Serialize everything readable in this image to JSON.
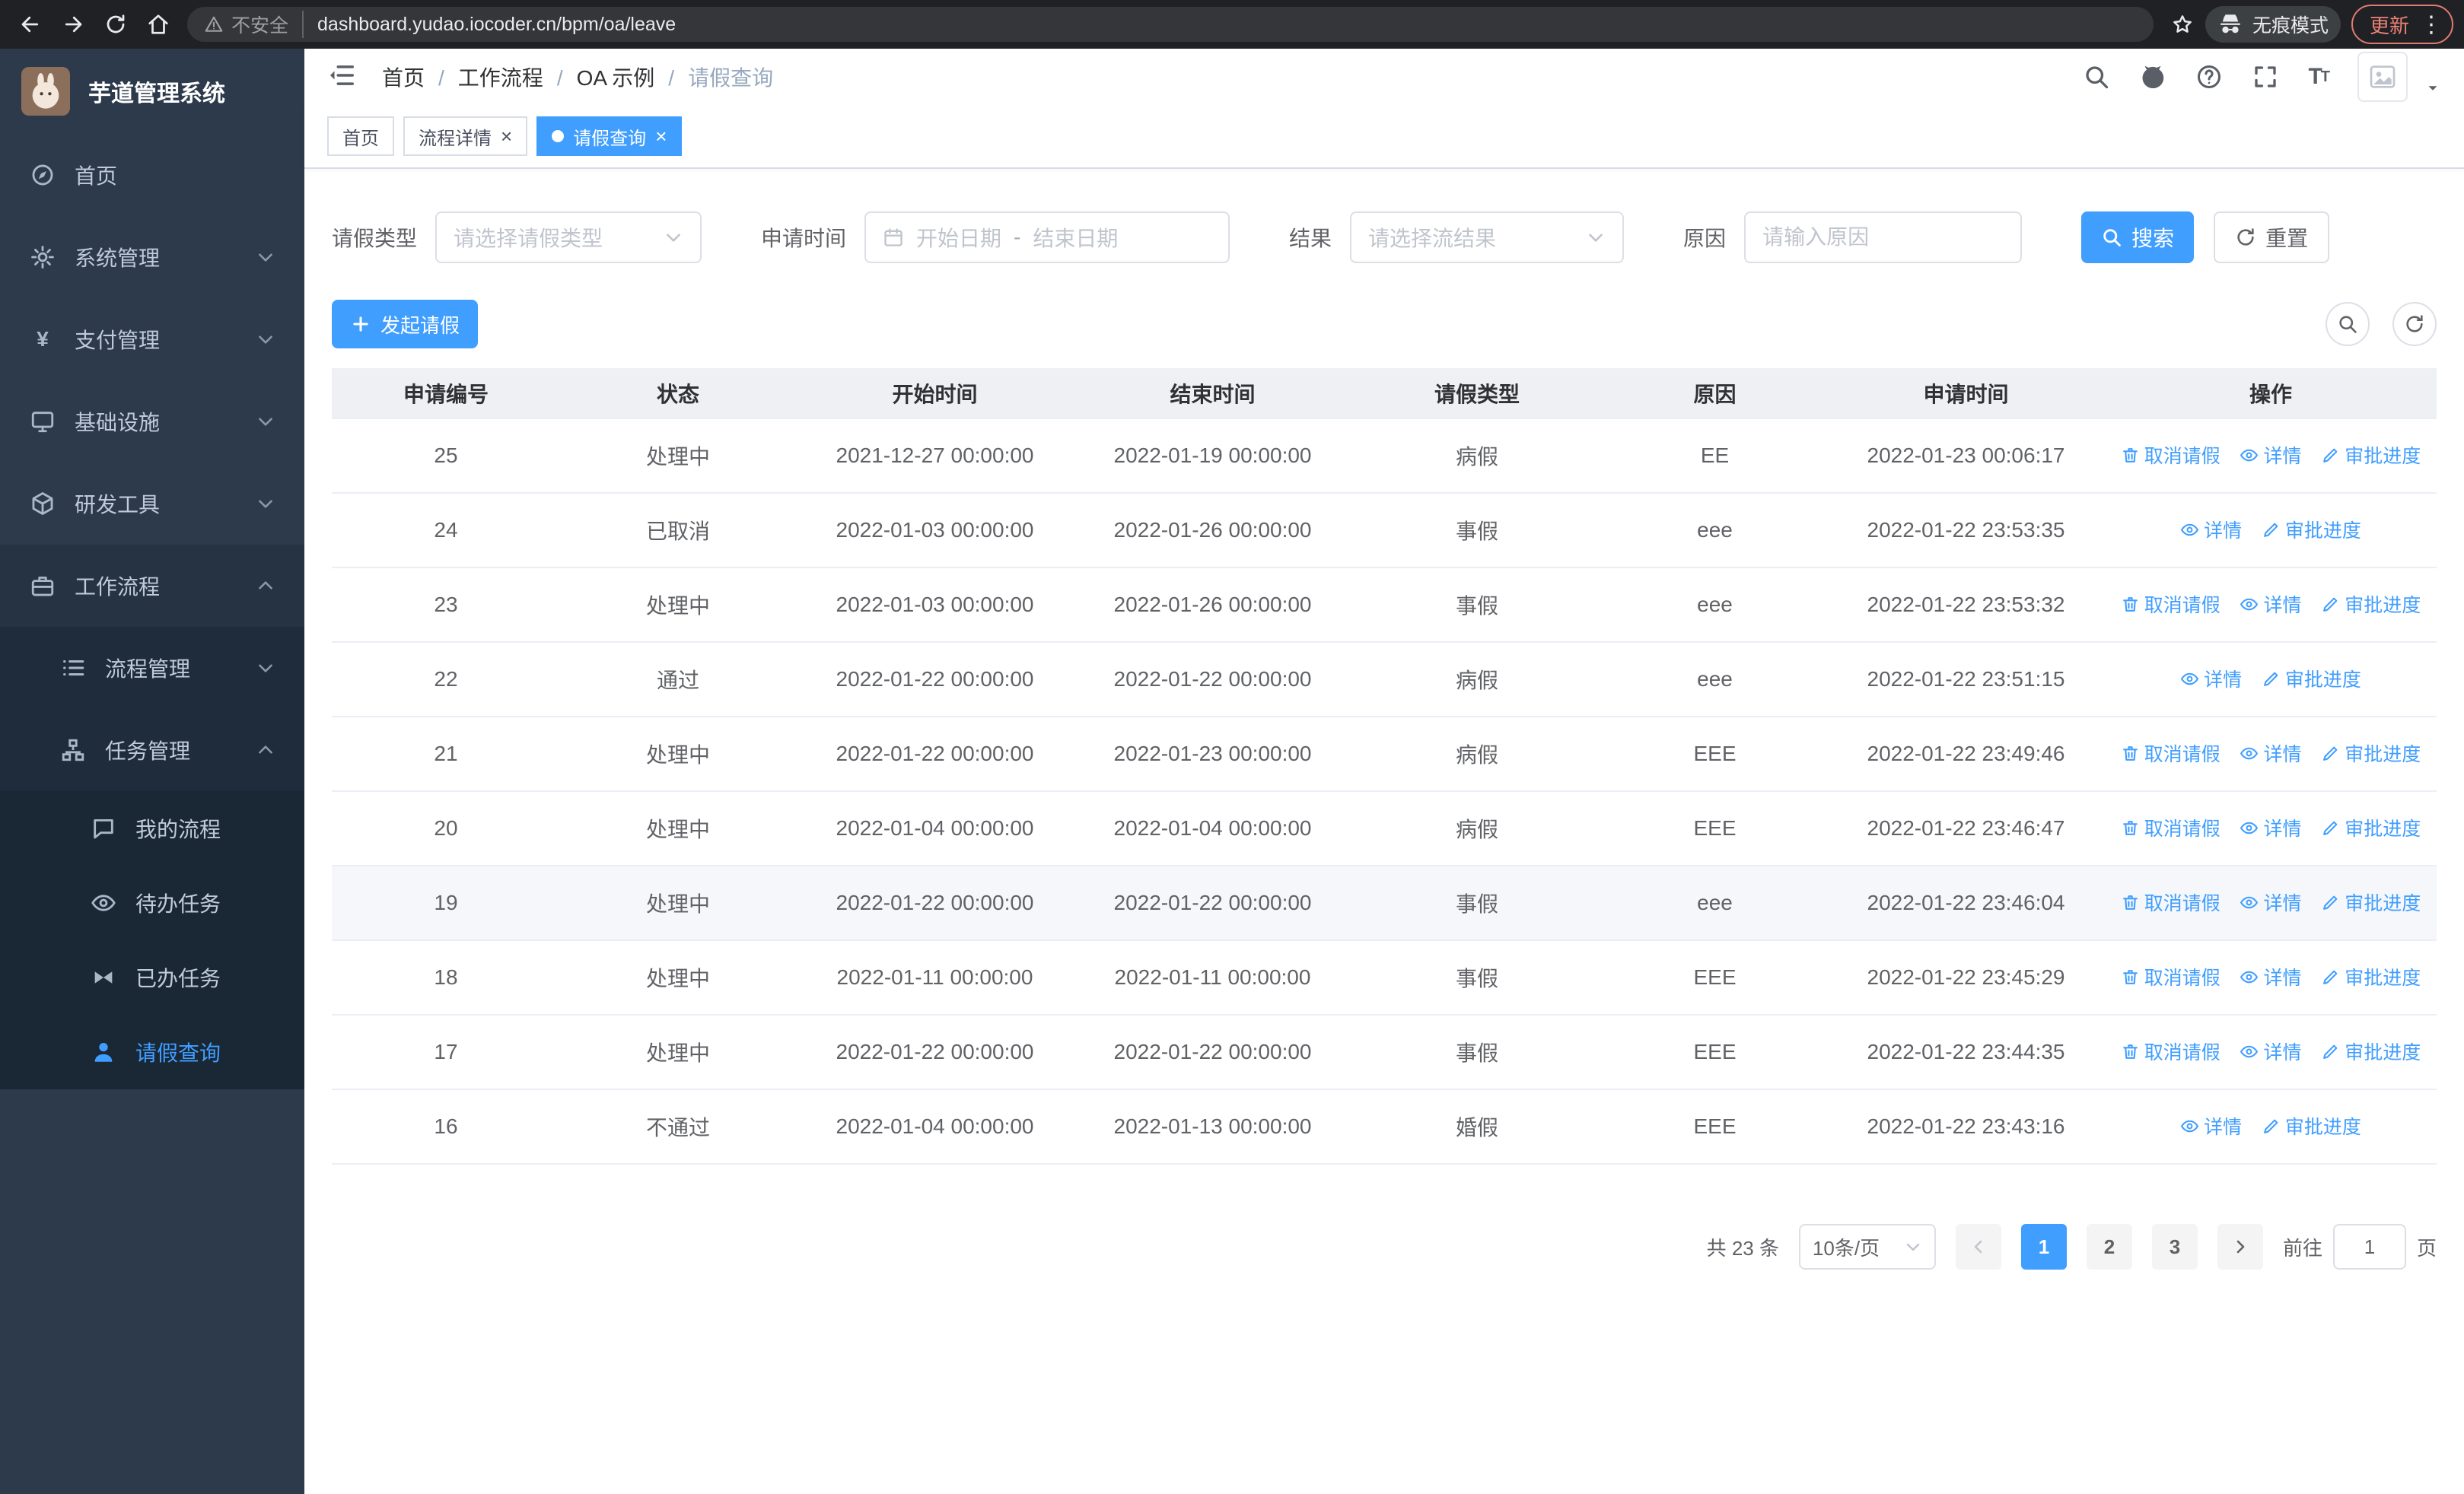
{
  "browser": {
    "security_label": "不安全",
    "url": "dashboard.yudao.iocoder.cn/bpm/oa/leave",
    "incognito_label": "无痕模式",
    "update_label": "更新"
  },
  "icons": {
    "close": "×",
    "kebab": "⋮",
    "yen": "¥"
  },
  "sidebar": {
    "logo_title": "芋道管理系统",
    "home": "首页",
    "system": "系统管理",
    "payment": "支付管理",
    "infrastructure": "基础设施",
    "devtools": "研发工具",
    "workflow": "工作流程",
    "process_mgmt": "流程管理",
    "task_mgmt": "任务管理",
    "my_process": "我的流程",
    "todo_tasks": "待办任务",
    "done_tasks": "已办任务",
    "leave_query": "请假查询"
  },
  "header": {
    "breadcrumb": [
      "首页",
      "工作流程",
      "OA 示例",
      "请假查询"
    ]
  },
  "tabs": [
    {
      "label": "首页"
    },
    {
      "label": "流程详情"
    },
    {
      "label": "请假查询"
    }
  ],
  "filters": {
    "leave_type_label": "请假类型",
    "leave_type_placeholder": "请选择请假类型",
    "apply_time_label": "申请时间",
    "start_date_placeholder": "开始日期",
    "range_separator": "-",
    "end_date_placeholder": "结束日期",
    "result_label": "结果",
    "result_placeholder": "请选择流结果",
    "reason_label": "原因",
    "reason_placeholder": "请输入原因",
    "search_button": "搜索",
    "reset_button": "重置"
  },
  "toolbar": {
    "create_button": "发起请假"
  },
  "table": {
    "columns": [
      "申请编号",
      "状态",
      "开始时间",
      "结束时间",
      "请假类型",
      "原因",
      "申请时间",
      "操作"
    ],
    "action_labels": {
      "cancel": "取消请假",
      "detail": "详情",
      "progress": "审批进度"
    },
    "rows": [
      {
        "id": "25",
        "status": "处理中",
        "start": "2021-12-27 00:00:00",
        "end": "2022-01-19 00:00:00",
        "type": "病假",
        "reason": "EE",
        "applied": "2022-01-23 00:06:17",
        "can_cancel": true,
        "hover": false
      },
      {
        "id": "24",
        "status": "已取消",
        "start": "2022-01-03 00:00:00",
        "end": "2022-01-26 00:00:00",
        "type": "事假",
        "reason": "eee",
        "applied": "2022-01-22 23:53:35",
        "can_cancel": false,
        "hover": false
      },
      {
        "id": "23",
        "status": "处理中",
        "start": "2022-01-03 00:00:00",
        "end": "2022-01-26 00:00:00",
        "type": "事假",
        "reason": "eee",
        "applied": "2022-01-22 23:53:32",
        "can_cancel": true,
        "hover": false
      },
      {
        "id": "22",
        "status": "通过",
        "start": "2022-01-22 00:00:00",
        "end": "2022-01-22 00:00:00",
        "type": "病假",
        "reason": "eee",
        "applied": "2022-01-22 23:51:15",
        "can_cancel": false,
        "hover": false
      },
      {
        "id": "21",
        "status": "处理中",
        "start": "2022-01-22 00:00:00",
        "end": "2022-01-23 00:00:00",
        "type": "病假",
        "reason": "EEE",
        "applied": "2022-01-22 23:49:46",
        "can_cancel": true,
        "hover": false
      },
      {
        "id": "20",
        "status": "处理中",
        "start": "2022-01-04 00:00:00",
        "end": "2022-01-04 00:00:00",
        "type": "病假",
        "reason": "EEE",
        "applied": "2022-01-22 23:46:47",
        "can_cancel": true,
        "hover": false
      },
      {
        "id": "19",
        "status": "处理中",
        "start": "2022-01-22 00:00:00",
        "end": "2022-01-22 00:00:00",
        "type": "事假",
        "reason": "eee",
        "applied": "2022-01-22 23:46:04",
        "can_cancel": true,
        "hover": true
      },
      {
        "id": "18",
        "status": "处理中",
        "start": "2022-01-11 00:00:00",
        "end": "2022-01-11 00:00:00",
        "type": "事假",
        "reason": "EEE",
        "applied": "2022-01-22 23:45:29",
        "can_cancel": true,
        "hover": false
      },
      {
        "id": "17",
        "status": "处理中",
        "start": "2022-01-22 00:00:00",
        "end": "2022-01-22 00:00:00",
        "type": "事假",
        "reason": "EEE",
        "applied": "2022-01-22 23:44:35",
        "can_cancel": true,
        "hover": false
      },
      {
        "id": "16",
        "status": "不通过",
        "start": "2022-01-04 00:00:00",
        "end": "2022-01-13 00:00:00",
        "type": "婚假",
        "reason": "EEE",
        "applied": "2022-01-22 23:43:16",
        "can_cancel": false,
        "hover": false
      }
    ]
  },
  "pagination": {
    "total_text": "共 23 条",
    "page_size_value": "10条/页",
    "pages": [
      "1",
      "2",
      "3"
    ],
    "goto_label": "前往",
    "goto_value": "1",
    "page_unit_label": "页"
  }
}
